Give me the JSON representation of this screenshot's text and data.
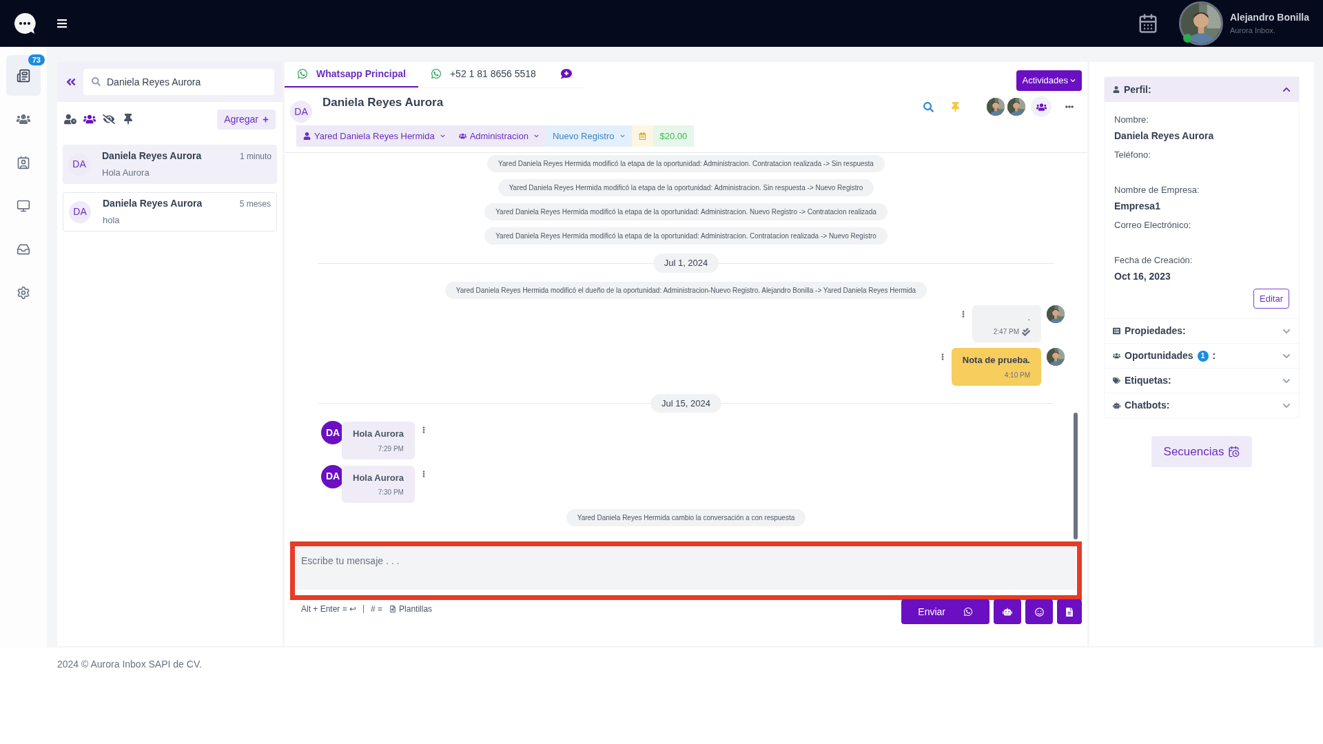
{
  "topbar": {
    "user_name": "Alejandro Bonilla",
    "user_org": "Aurora Inbox.",
    "online": true
  },
  "nav": [
    {
      "kind": "chats",
      "badge": "73",
      "selected": true
    },
    {
      "kind": "contacts",
      "selected": false
    },
    {
      "kind": "board",
      "selected": false
    },
    {
      "kind": "monitor",
      "selected": false
    },
    {
      "kind": "inbox",
      "selected": false
    },
    {
      "kind": "settings",
      "selected": false
    }
  ],
  "contacts_panel": {
    "search": {
      "value": "Daniela Reyes Aurora"
    },
    "filters": [
      {
        "kind": "user-clock",
        "selected": false
      },
      {
        "kind": "group",
        "selected": true
      },
      {
        "kind": "hidden",
        "selected": false
      },
      {
        "kind": "pin",
        "selected": false
      }
    ],
    "add_button": "Agregar",
    "conversations": [
      {
        "initials": "DA",
        "name": "Daniela Reyes Aurora",
        "time": "1 minuto",
        "preview": "Hola Aurora",
        "selected": true
      },
      {
        "initials": "DA",
        "name": "Daniela Reyes Aurora",
        "time": "5 meses",
        "preview": "hola",
        "selected": false
      }
    ]
  },
  "chat": {
    "tabs": [
      {
        "kind": "whatsapp",
        "label": "Whatsapp Principal",
        "selected": true
      },
      {
        "kind": "whatsapp",
        "label": "+52 1 81 8656 5518",
        "selected": false
      },
      {
        "kind": "new-chat",
        "selected": false
      }
    ],
    "activities_button": "Actividades",
    "contact": {
      "initials": "DA",
      "name": "Daniela Reyes Aurora"
    },
    "tags": [
      {
        "kind": "owner",
        "label": "Yared Daniela Reyes Hermida"
      },
      {
        "kind": "team",
        "label": "Administracion"
      },
      {
        "kind": "stage",
        "label": "Nuevo Registro"
      },
      {
        "kind": "calendar"
      },
      {
        "kind": "amount",
        "label": "$20.00"
      }
    ],
    "messages": [
      {
        "kind": "event",
        "text": "Yared Daniela Reyes Hermida modificó la etapa de la oportunidad: Administracion. Contratacion realizada -> Sin respuesta"
      },
      {
        "kind": "event",
        "text": "Yared Daniela Reyes Hermida modificó la etapa de la oportunidad: Administracion. Sin respuesta -> Nuevo Registro"
      },
      {
        "kind": "event",
        "text": "Yared Daniela Reyes Hermida modificó la etapa de la oportunidad: Administracion. Nuevo Registro -> Contratacion realizada"
      },
      {
        "kind": "event",
        "text": "Yared Daniela Reyes Hermida modificó la etapa de la oportunidad: Administracion. Contratacion realizada -> Nuevo Registro"
      },
      {
        "kind": "date",
        "text": "Jul 1, 2024"
      },
      {
        "kind": "event",
        "text": "Yared Daniela Reyes Hermida modificó el dueño de la oportunidad: Administracion-Nuevo Registro. Alejandro Bonilla -> Yared Daniela Reyes Hermida"
      },
      {
        "kind": "outgoing",
        "text": ".",
        "time": "2:47 PM",
        "read": true
      },
      {
        "kind": "note",
        "text": "Nota de prueba.",
        "time": "4:10 PM"
      },
      {
        "kind": "date",
        "text": "Jul 15, 2024"
      },
      {
        "kind": "incoming",
        "initials": "DA",
        "text": "Hola Aurora",
        "time": "7:29 PM"
      },
      {
        "kind": "incoming",
        "initials": "DA",
        "text": "Hola Aurora",
        "time": "7:30 PM"
      },
      {
        "kind": "event",
        "text": "Yared Daniela Reyes Hermida cambio la conversación a con respuesta"
      }
    ],
    "composer": {
      "placeholder": "Escribe tu mensaje . . .",
      "shortcut_hint": "Alt + Enter = ↩",
      "templates_key": "# =",
      "templates_label": "Plantillas",
      "send_button": "Enviar"
    }
  },
  "profile": {
    "title": "Perfil:",
    "expanded": true,
    "fields": [
      {
        "label": "Nombre:",
        "value": "Daniela Reyes Aurora"
      },
      {
        "label": "Teléfono:"
      },
      {
        "label": "Nombre de Empresa:",
        "value": "Empresa1"
      },
      {
        "label": "Correo Electrónico:"
      },
      {
        "label": "Fecha de Creación:",
        "value": "Oct 16, 2023"
      }
    ],
    "edit_button": "Editar",
    "sections": [
      {
        "kind": "properties",
        "title": "Propiedades:",
        "expanded": false
      },
      {
        "kind": "opportunities",
        "title": "Oportunidades",
        "badge": "1",
        "suffix": ":",
        "expanded": false
      },
      {
        "kind": "tags",
        "title": "Etiquetas:",
        "expanded": false
      },
      {
        "kind": "chatbots",
        "title": "Chatbots:",
        "expanded": false
      }
    ],
    "sequences_button": "Secuencias"
  },
  "footer": "2024 © Aurora Inbox SAPI de CV."
}
